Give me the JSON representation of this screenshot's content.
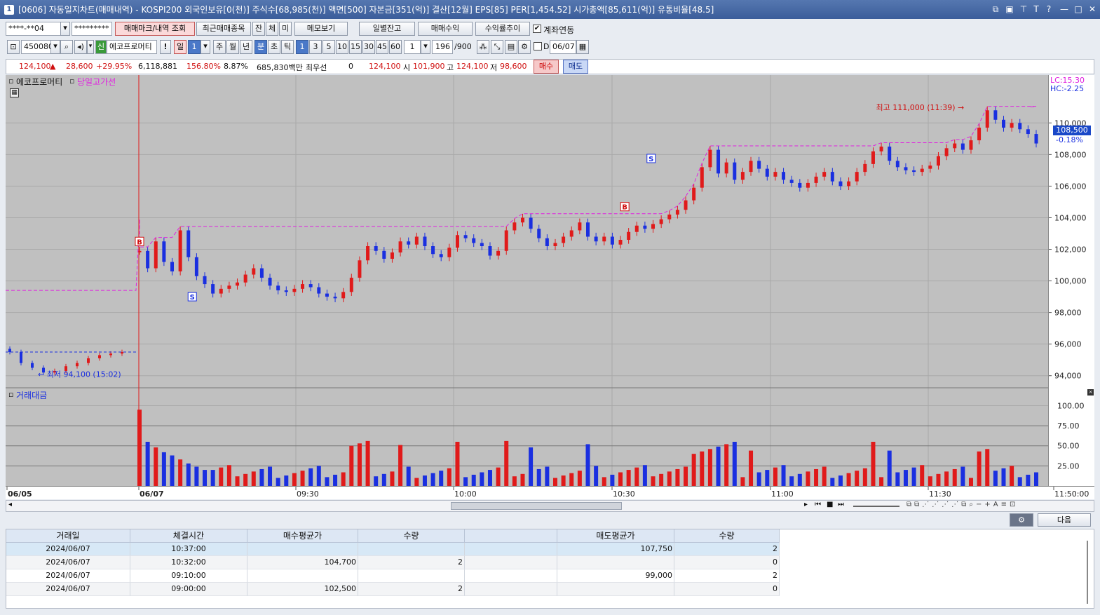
{
  "window": {
    "number": "1",
    "title": "[0606] 자동일지차트(매매내역) - KOSPI200 외국인보유[0(천)] 주식수[68,985(천)] 액면[500] 자본금[351(억)] 결산[12월] EPS[85] PER[1,454.52] 시가총액[85,611(억)] 유통비율[48.5]"
  },
  "toolbar1": {
    "account": "****-**04",
    "password": "*********",
    "btn_mark": "매매마크/내역 조회",
    "btn_recent": "최근매매종목",
    "btn_jan": "잔",
    "btn_che": "체",
    "btn_mi": "미",
    "btn_memo": "메모보기",
    "btn_daily": "일별잔고",
    "btn_profit": "매매수익",
    "btn_rate": "수익률추이",
    "link_label": "계좌연동"
  },
  "toolbar2": {
    "code": "450080",
    "badge": "신",
    "name": "에코프로머티",
    "excl": "!",
    "day_label": "일",
    "day_value": "1",
    "periods": [
      "주",
      "월",
      "년",
      "분",
      "초",
      "틱"
    ],
    "minutes": [
      "1",
      "3",
      "5",
      "10",
      "15",
      "30",
      "45",
      "60"
    ],
    "unit_value": "1",
    "count": "196",
    "count_total": "/900",
    "d_label": "D",
    "date": "06/07"
  },
  "quote": {
    "price": "124,100",
    "change": "28,600",
    "rate": "+29.95%",
    "volume": "6,118,881",
    "vol_rate": "156.80%",
    "turnover": "8.87%",
    "amount": "685,830백만",
    "pref_label": "최우선",
    "pref_qty": "0",
    "pref_price": "124,100",
    "open_label": "시",
    "open": "101,900",
    "high_label": "고",
    "high": "124,100",
    "low_label": "저",
    "low": "98,600",
    "buy_btn": "매수",
    "sell_btn": "매도"
  },
  "chart": {
    "legend_name": "에코프로머티",
    "legend_line": "당일고가선",
    "lc": "LC:15.30",
    "hc": "HC:-2.25",
    "current_price": "108,500",
    "current_rate": "-0.18%",
    "high_annot": "최고 111,000 (11:39)",
    "low_annot": "최저 94,100 (15:02)",
    "volume_label": "거래대금",
    "colors": {
      "up": "#e01a1a",
      "down": "#1a2fe0",
      "highline": "#e020e0",
      "bg": "#c0c0c0"
    }
  },
  "chart_data": {
    "type": "candlestick",
    "title": "",
    "y_ticks": [
      "110,000",
      "108,000",
      "106,000",
      "104,000",
      "102,000",
      "100,000",
      "98,000",
      "96,000",
      "94,000"
    ],
    "ylim": [
      93500,
      111700
    ],
    "vol_ticks": [
      "100.00",
      "75.00",
      "50.00",
      "25.00"
    ],
    "vol_lim": [
      0,
      110
    ],
    "x_ticks": [
      "06/05",
      "06/07",
      "09:30",
      "10:00",
      "10:30",
      "11:00",
      "11:30",
      "11:50:00"
    ],
    "prev_day_close_approx": [
      95500,
      94800,
      94500,
      94200,
      94300,
      94600,
      94800,
      95100,
      95300,
      95400,
      95500
    ],
    "series_close_approx": [
      101900,
      100800,
      102500,
      101200,
      100600,
      103200,
      101500,
      100300,
      99800,
      99200,
      99500,
      99700,
      99900,
      100400,
      100800,
      100200,
      99700,
      99400,
      99300,
      99500,
      99800,
      99600,
      99200,
      99000,
      98900,
      99300,
      100200,
      101300,
      102200,
      101900,
      101400,
      101800,
      102500,
      102300,
      102800,
      102200,
      101700,
      101500,
      102100,
      102900,
      102700,
      102400,
      102200,
      101600,
      101900,
      103200,
      103700,
      104000,
      103300,
      102700,
      102200,
      102400,
      102800,
      103200,
      103700,
      102800,
      102500,
      102800,
      102300,
      102600,
      103100,
      103500,
      103300,
      103600,
      103900,
      104200,
      104500,
      105100,
      105900,
      107200,
      108300,
      106800,
      107500,
      106400,
      106900,
      107600,
      107100,
      106600,
      106900,
      106400,
      106200,
      105900,
      106200,
      106600,
      106900,
      106300,
      106000,
      106300,
      106900,
      107400,
      108200,
      108500,
      107600,
      107200,
      107000,
      106900,
      107100,
      107300,
      107900,
      108400,
      108700,
      108300,
      108900,
      109700,
      110800,
      110200,
      109700,
      110000,
      109600,
      109300,
      108700
    ],
    "buy_markers": [
      {
        "time": "09:00",
        "price": 102500
      },
      {
        "time": "10:32",
        "price": 104700
      }
    ],
    "sell_markers": [
      {
        "time": "09:10",
        "price": 99000
      },
      {
        "time": "10:37",
        "price": 107750
      }
    ],
    "day_high": 111000,
    "day_high_time": "11:39",
    "prev_day_low": 94100,
    "prev_day_low_time": "15:02"
  },
  "controls": {
    "next_btn": "다음"
  },
  "table": {
    "headers": [
      "거래일",
      "체결시간",
      "매수평균가",
      "수량",
      "",
      "매도평균가",
      "수량"
    ],
    "rows": [
      [
        "2024/06/07",
        "10:37:00",
        "",
        "",
        "",
        "107,750",
        "2"
      ],
      [
        "2024/06/07",
        "10:32:00",
        "104,700",
        "2",
        "",
        "",
        "0"
      ],
      [
        "2024/06/07",
        "09:10:00",
        "",
        "",
        "",
        "99,000",
        "2"
      ],
      [
        "2024/06/07",
        "09:00:00",
        "102,500",
        "2",
        "",
        "",
        "0"
      ]
    ]
  }
}
